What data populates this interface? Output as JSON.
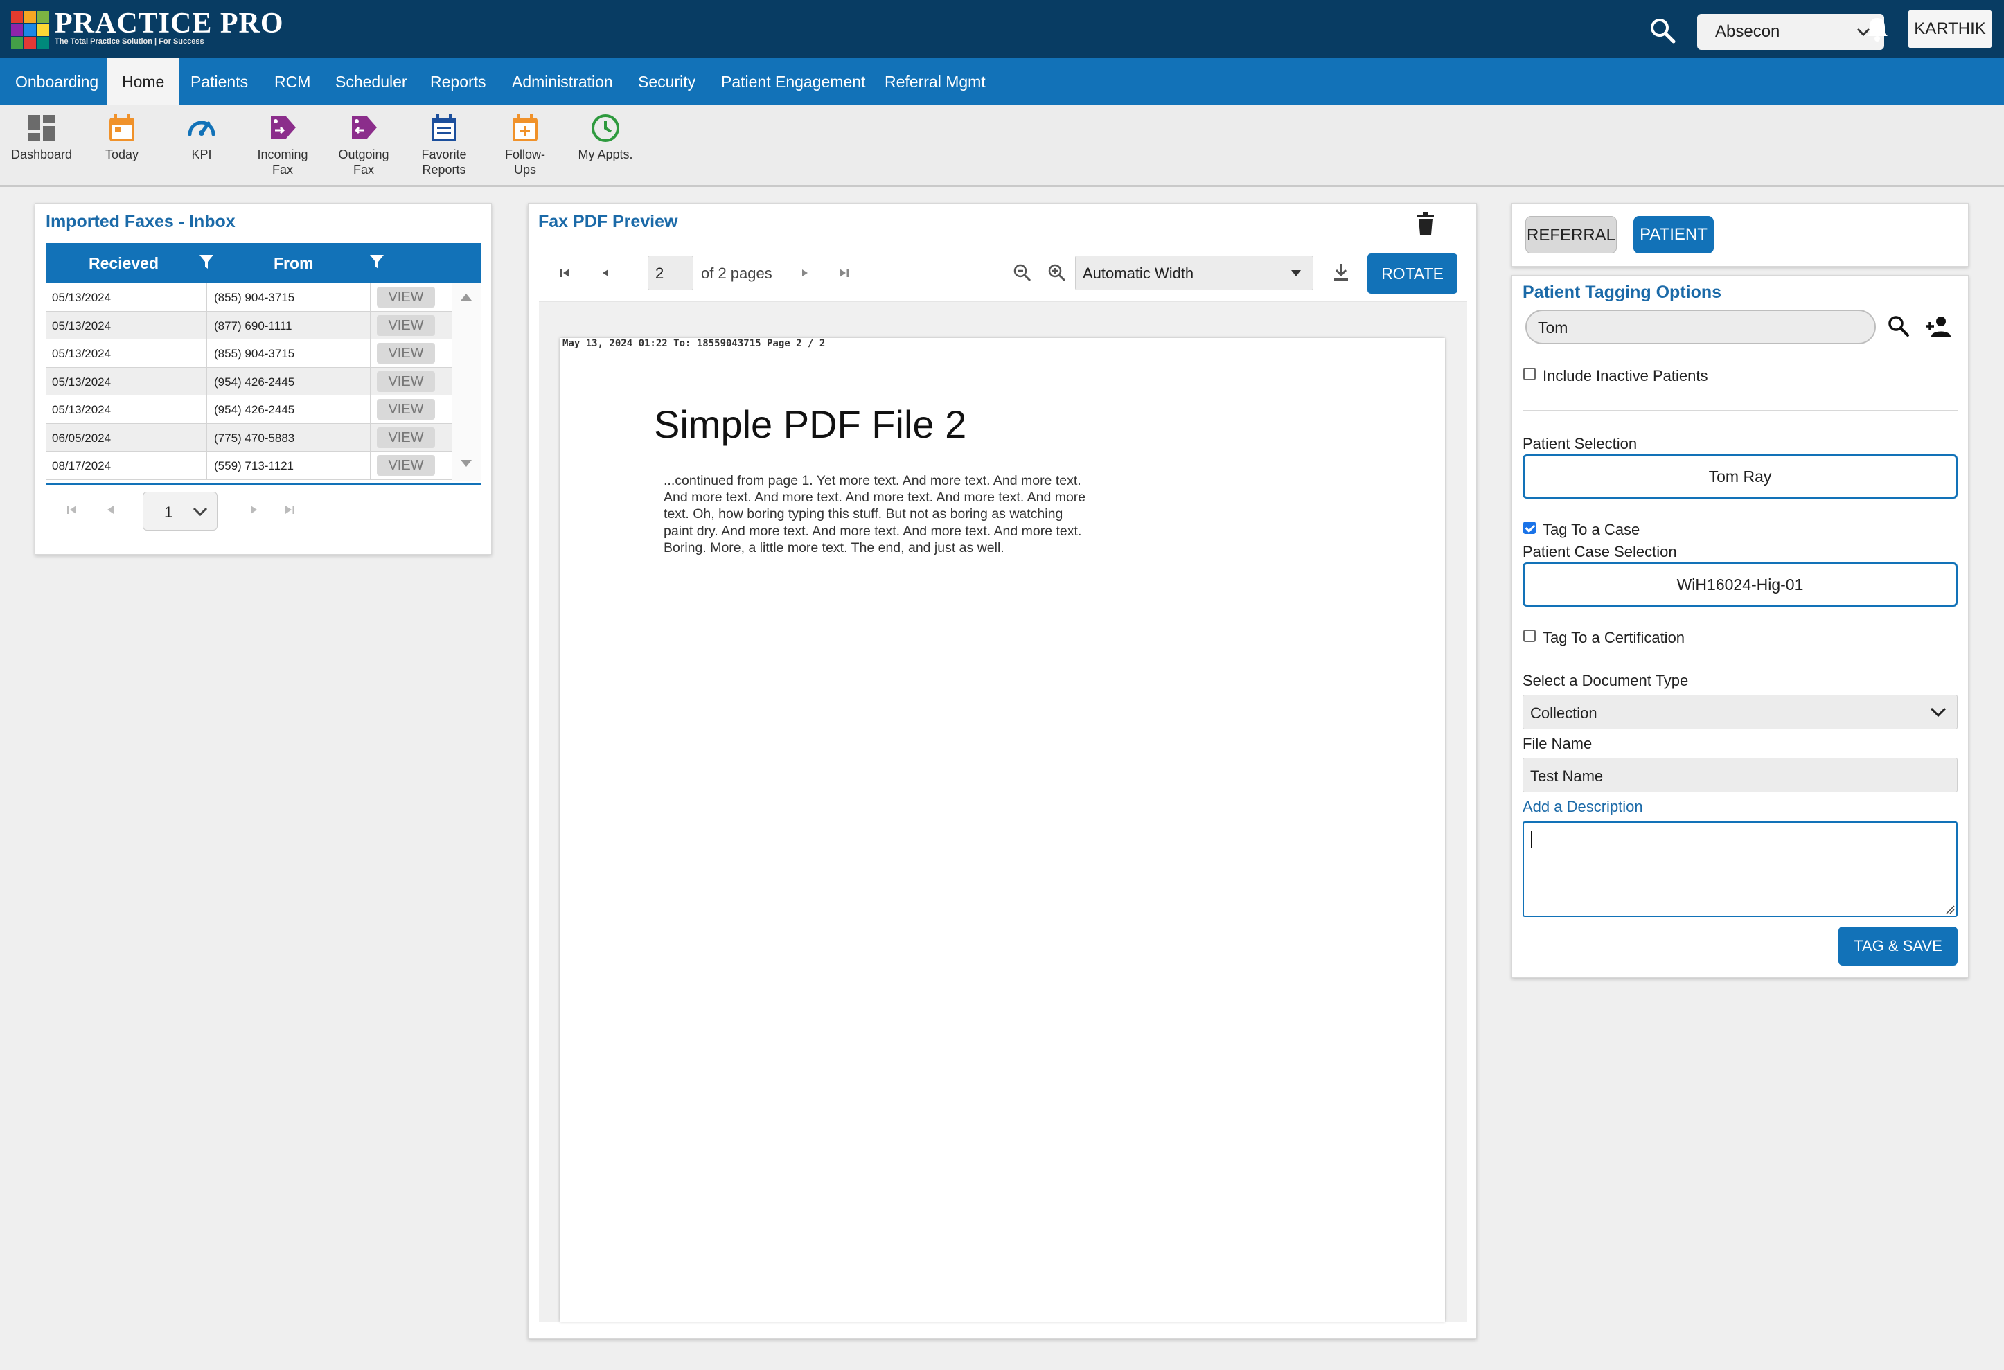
{
  "header": {
    "brand": "PRACTICE PRO",
    "tagline": "The Total Practice Solution | For Success",
    "location": "Absecon",
    "user": "KARTHIK"
  },
  "nav": {
    "items": [
      {
        "label": "Onboarding"
      },
      {
        "label": "Home",
        "active": true
      },
      {
        "label": "Patients"
      },
      {
        "label": "RCM"
      },
      {
        "label": "Scheduler"
      },
      {
        "label": "Reports"
      },
      {
        "label": "Administration"
      },
      {
        "label": "Security"
      },
      {
        "label": "Patient Engagement"
      },
      {
        "label": "Referral Mgmt"
      }
    ]
  },
  "toolbar": {
    "items": [
      {
        "line1": "Dashboard",
        "line2": "",
        "icon": "dashboard-icon",
        "color": "#6b6b6b"
      },
      {
        "line1": "Today",
        "line2": "",
        "icon": "calendar-today-icon",
        "color": "#f0922b"
      },
      {
        "line1": "KPI",
        "line2": "",
        "icon": "speedometer-icon",
        "color": "#1272b8"
      },
      {
        "line1": "Incoming",
        "line2": "Fax",
        "icon": "incoming-fax-icon",
        "color": "#8b2d8b"
      },
      {
        "line1": "Outgoing",
        "line2": "Fax",
        "icon": "outgoing-fax-icon",
        "color": "#8b2d8b"
      },
      {
        "line1": "Favorite",
        "line2": "Reports",
        "icon": "favorite-reports-icon",
        "color": "#1c4f9c"
      },
      {
        "line1": "Follow-",
        "line2": "Ups",
        "icon": "follow-ups-icon",
        "color": "#f0922b"
      },
      {
        "line1": "My Appts.",
        "line2": "",
        "icon": "clock-icon",
        "color": "#2e9a3e"
      }
    ]
  },
  "inbox": {
    "title": "Imported Faxes - Inbox",
    "columns": [
      "Recieved",
      "From"
    ],
    "view_label": "VIEW",
    "rows": [
      {
        "received": "05/13/2024",
        "from": "(855) 904-3715"
      },
      {
        "received": "05/13/2024",
        "from": "(877) 690-1111"
      },
      {
        "received": "05/13/2024",
        "from": "(855) 904-3715"
      },
      {
        "received": "05/13/2024",
        "from": "(954) 426-2445"
      },
      {
        "received": "05/13/2024",
        "from": "(954) 426-2445"
      },
      {
        "received": "06/05/2024",
        "from": "(775) 470-5883"
      },
      {
        "received": "08/17/2024",
        "from": "(559) 713-1121"
      }
    ],
    "page": "1"
  },
  "preview": {
    "title": "Fax PDF Preview",
    "page_number": "2",
    "page_count": "of 2 pages",
    "zoom": "Automatic Width",
    "rotate_label": "ROTATE",
    "doc": {
      "fax_header": "May 13, 2024 01:22 To: 18559043715 Page 2 / 2",
      "heading": "Simple PDF File 2",
      "body_lines": [
        "...continued from page 1. Yet more text. And more text. And more text.",
        "And more text. And more text. And more text. And more text. And more",
        "text. Oh, how boring typing this stuff. But not as boring as watching",
        "paint dry. And more text. And more text. And more text. And more text.",
        "Boring.  More, a little more text. The end, and just as well."
      ]
    }
  },
  "tagging": {
    "referral_label": "REFERRAL",
    "patient_label": "PATIENT",
    "title": "Patient Tagging Options",
    "search_value": "Tom",
    "include_inactive_label": "Include Inactive Patients",
    "include_inactive": false,
    "patient_selection_label": "Patient Selection",
    "patient_selection": "Tom Ray",
    "tag_case_label": "Tag To a Case",
    "tag_case": true,
    "case_selection_label": "Patient Case Selection",
    "case_selection": "WiH16024-Hig-01",
    "tag_cert_label": "Tag To a Certification",
    "tag_cert": false,
    "doc_type_label": "Select a Document Type",
    "doc_type": "Collection",
    "file_name_label": "File Name",
    "file_name": "Test Name",
    "description_link": "Add a Description",
    "description": "",
    "save_label": "TAG & SAVE"
  }
}
